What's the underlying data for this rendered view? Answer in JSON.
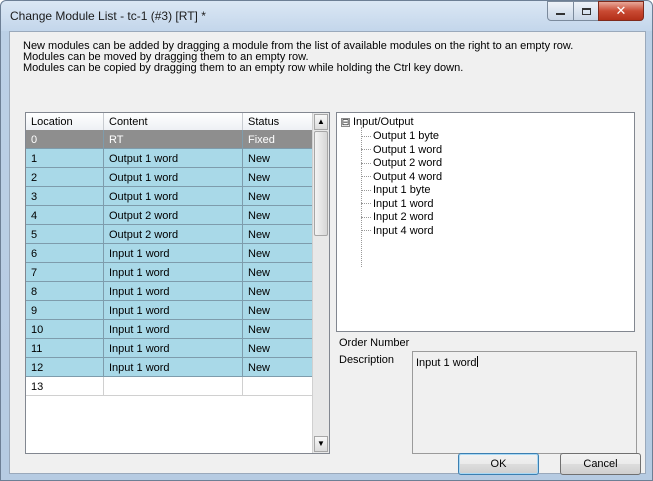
{
  "window": {
    "title": "Change Module List - tc-1 (#3) [RT] *",
    "minimize_glyph": "",
    "close_glyph": "✕"
  },
  "instructions": [
    "New modules can be added by dragging a module from the list of available modules on the right to an empty row.",
    "Modules can be moved by dragging them to an empty row.",
    "Modules can be copied by dragging them to an empty row while holding the Ctrl key down."
  ],
  "grid": {
    "columns": [
      "Location",
      "Content",
      "Status"
    ],
    "rows": [
      {
        "location": "0",
        "content": "RT",
        "status": "Fixed",
        "kind": "fixed"
      },
      {
        "location": "1",
        "content": "Output 1 word",
        "status": "New",
        "kind": "new"
      },
      {
        "location": "2",
        "content": "Output 1 word",
        "status": "New",
        "kind": "new"
      },
      {
        "location": "3",
        "content": "Output 1 word",
        "status": "New",
        "kind": "new"
      },
      {
        "location": "4",
        "content": "Output 2 word",
        "status": "New",
        "kind": "new"
      },
      {
        "location": "5",
        "content": "Output 2 word",
        "status": "New",
        "kind": "new"
      },
      {
        "location": "6",
        "content": "Input 1 word",
        "status": "New",
        "kind": "new"
      },
      {
        "location": "7",
        "content": "Input 1 word",
        "status": "New",
        "kind": "new"
      },
      {
        "location": "8",
        "content": "Input 1 word",
        "status": "New",
        "kind": "new"
      },
      {
        "location": "9",
        "content": "Input 1 word",
        "status": "New",
        "kind": "new"
      },
      {
        "location": "10",
        "content": "Input 1 word",
        "status": "New",
        "kind": "new"
      },
      {
        "location": "11",
        "content": "Input 1 word",
        "status": "New",
        "kind": "new"
      },
      {
        "location": "12",
        "content": "Input 1 word",
        "status": "New",
        "kind": "new"
      },
      {
        "location": "13",
        "content": "",
        "status": "",
        "kind": "empty"
      }
    ],
    "scroll_up_glyph": "▲",
    "scroll_down_glyph": "▼"
  },
  "tree": {
    "expander": "⊟",
    "root": "Input/Output",
    "items": [
      "Output 1 byte",
      "Output 1 word",
      "Output 2 word",
      "Output 4 word",
      "Input 1 byte",
      "Input 1 word",
      "Input 2 word",
      "Input 4 word"
    ]
  },
  "properties": {
    "order_number_label": "Order Number",
    "description_label": "Description",
    "description_value": "Input 1 word"
  },
  "buttons": {
    "ok": "OK",
    "cancel": "Cancel"
  },
  "colors": {
    "new_row": "#a9d9e8",
    "fixed_row": "#8e8e8e"
  }
}
